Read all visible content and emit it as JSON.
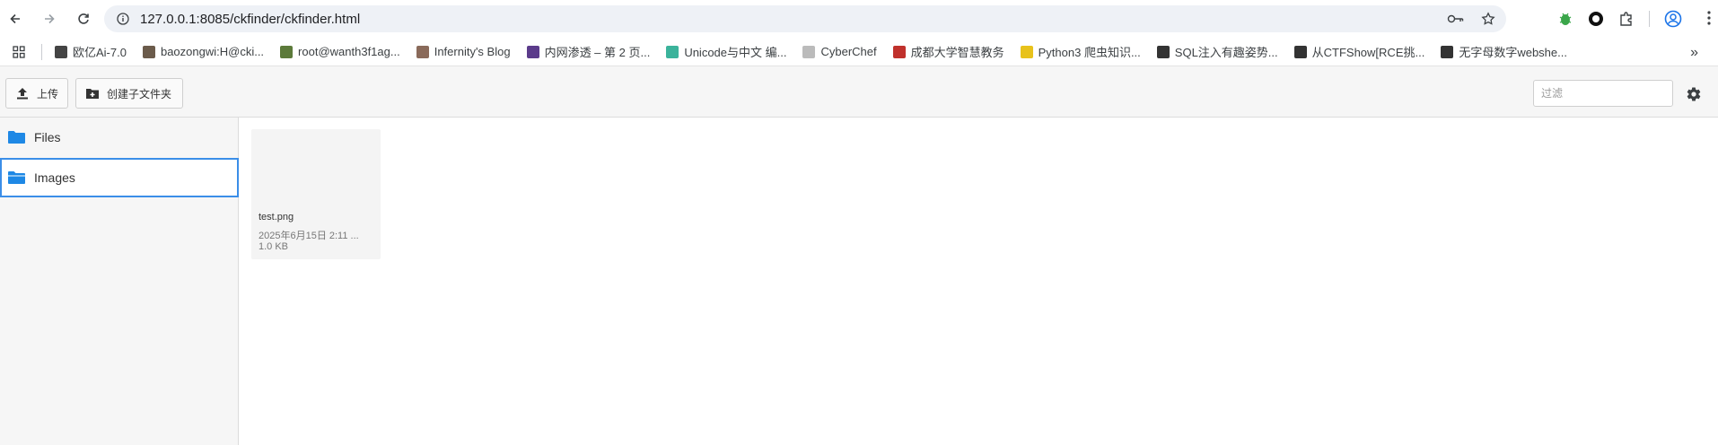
{
  "browser": {
    "url": "127.0.0.1:8085/ckfinder/ckfinder.html",
    "bookmarks": [
      {
        "label": "欧亿Ai-7.0",
        "icon": "ai-favicon",
        "color": "#444444"
      },
      {
        "label": "baozongwi:H@cki...",
        "icon": "avatar-favicon",
        "color": "#6b5b4b"
      },
      {
        "label": "root@wanth3f1ag...",
        "icon": "plant-favicon",
        "color": "#5c7a3a"
      },
      {
        "label": "Infernity's Blog",
        "icon": "person-favicon",
        "color": "#8a6a5a"
      },
      {
        "label": "内网渗透 – 第 2 页...",
        "icon": "anime-favicon",
        "color": "#5b3b8b"
      },
      {
        "label": "Unicode与中文 编...",
        "icon": "leaf-favicon",
        "color": "#3bb39b"
      },
      {
        "label": "CyberChef",
        "icon": "chef-favicon",
        "color": "#bbbbbb"
      },
      {
        "label": "成都大学智慧教务",
        "icon": "university-favicon",
        "color": "#c0312c"
      },
      {
        "label": "Python3 爬虫知识...",
        "icon": "biohazard-favicon",
        "color": "#e8c21b"
      },
      {
        "label": "SQL注入有趣姿势...",
        "icon": "slash-favicon",
        "color": "#333333"
      },
      {
        "label": "从CTFShow[RCE挑...",
        "icon": "slash-favicon",
        "color": "#333333"
      },
      {
        "label": "无字母数字webshe...",
        "icon": "slash-favicon",
        "color": "#333333"
      }
    ],
    "overflow_label": "»"
  },
  "toolbar": {
    "upload_label": "上传",
    "create_folder_label": "创建子文件夹",
    "filter_placeholder": "过滤"
  },
  "folders": [
    {
      "label": "Files",
      "selected": false
    },
    {
      "label": "Images",
      "selected": true
    }
  ],
  "files": [
    {
      "name": "test.png",
      "date": "2025年6月15日 2:11 ...",
      "size": "1.0 KB"
    }
  ],
  "colors": {
    "folder": "#1e88e5",
    "selection_border": "#3b8ee8",
    "toolbar_bg": "#f6f6f6"
  }
}
